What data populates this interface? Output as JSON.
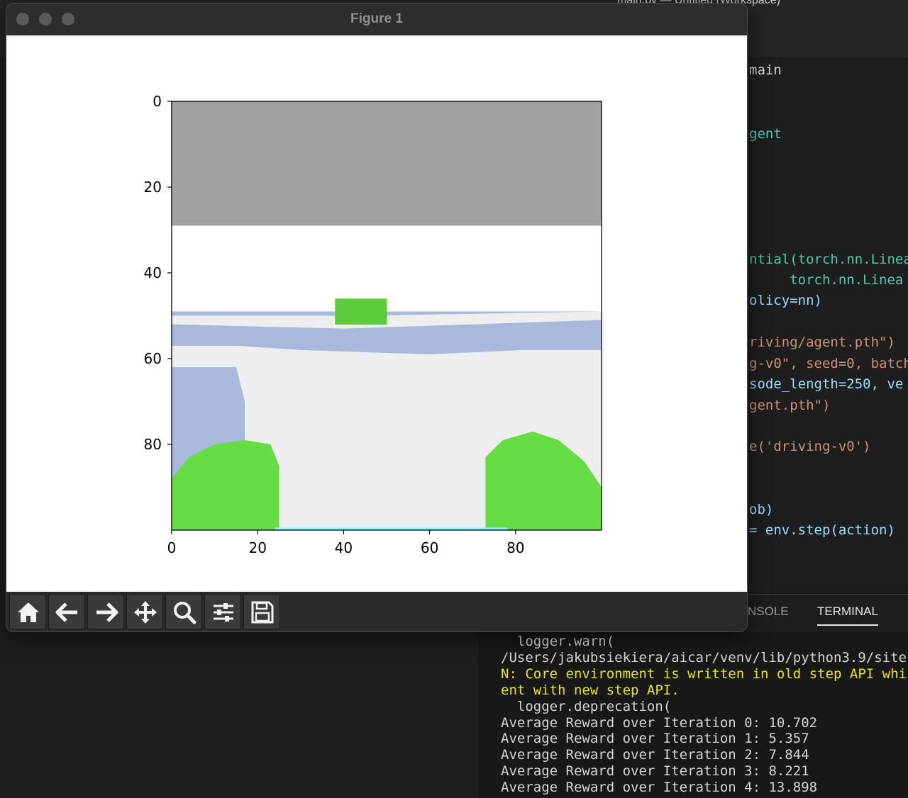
{
  "editor": {
    "title": "main.py — Untitled (Workspace)",
    "code_lines": [
      {
        "text": "main",
        "color": "#d4d4d4"
      },
      {
        "text": "gent",
        "color": "#4ec9b0"
      },
      {
        "text": "ntial(torch.nn.Linea",
        "color": "#4ec9b0"
      },
      {
        "text": "     torch.nn.Linea",
        "color": "#4ec9b0"
      },
      {
        "text": "olicy=nn)",
        "color": "#9cdcfe"
      },
      {
        "text": "riving/agent.pth\")",
        "color": "#ce9178"
      },
      {
        "text": "g-v0\", seed=0, batch",
        "color": "#ce9178"
      },
      {
        "text": "sode_length=250, ve",
        "color": "#9cdcfe"
      },
      {
        "text": "gent.pth\")",
        "color": "#ce9178"
      },
      {
        "text": "e('driving-v0')",
        "color": "#ce9178"
      },
      {
        "text": "ob)",
        "color": "#9cdcfe"
      },
      {
        "text": "= env.step(action)",
        "color": "#9cdcfe"
      }
    ],
    "panel_tabs": [
      "NSOLE",
      "TERMINAL"
    ],
    "terminal_lines": [
      {
        "text": "  logger.warn(",
        "warn": false
      },
      {
        "text": "/Users/jakubsiekiera/aicar/venv/lib/python3.9/site",
        "warn": false
      },
      {
        "text": "N: Core environment is written in old step API whi",
        "warn": true
      },
      {
        "text": "ent with new step API.",
        "warn": true
      },
      {
        "text": "  logger.deprecation(",
        "warn": false
      },
      {
        "text": "Average Reward over Iteration 0: 10.702",
        "warn": false
      },
      {
        "text": "Average Reward over Iteration 1: 5.357",
        "warn": false
      },
      {
        "text": "Average Reward over Iteration 2: 7.844",
        "warn": false
      },
      {
        "text": "Average Reward over Iteration 3: 8.221",
        "warn": false
      },
      {
        "text": "Average Reward over Iteration 4: 13.898",
        "warn": false
      }
    ]
  },
  "figure": {
    "title": "Figure 1",
    "toolbar": [
      {
        "name": "home-icon",
        "tooltip": "Home"
      },
      {
        "name": "back-arrow-icon",
        "tooltip": "Back"
      },
      {
        "name": "forward-arrow-icon",
        "tooltip": "Forward"
      },
      {
        "name": "pan-move-icon",
        "tooltip": "Pan"
      },
      {
        "name": "zoom-magnifier-icon",
        "tooltip": "Zoom"
      },
      {
        "name": "configure-subplots-icon",
        "tooltip": "Subplots"
      },
      {
        "name": "save-floppy-icon",
        "tooltip": "Save"
      }
    ]
  },
  "chart_data": {
    "type": "heatmap",
    "title": "",
    "xlabel": "",
    "ylabel": "",
    "xlim": [
      0,
      100
    ],
    "ylim": [
      100,
      0
    ],
    "xticks": [
      0,
      20,
      40,
      60,
      80
    ],
    "yticks": [
      0,
      20,
      40,
      60,
      80
    ],
    "image_description_colors": {
      "sky": "#a2a2a2",
      "horizon": "#ffffff",
      "grass": "#a9b9dc",
      "road": "#eeeeee",
      "car_body": "#5ccc3c",
      "trees": "#66dd44",
      "track_line": "#7ffaff"
    }
  }
}
